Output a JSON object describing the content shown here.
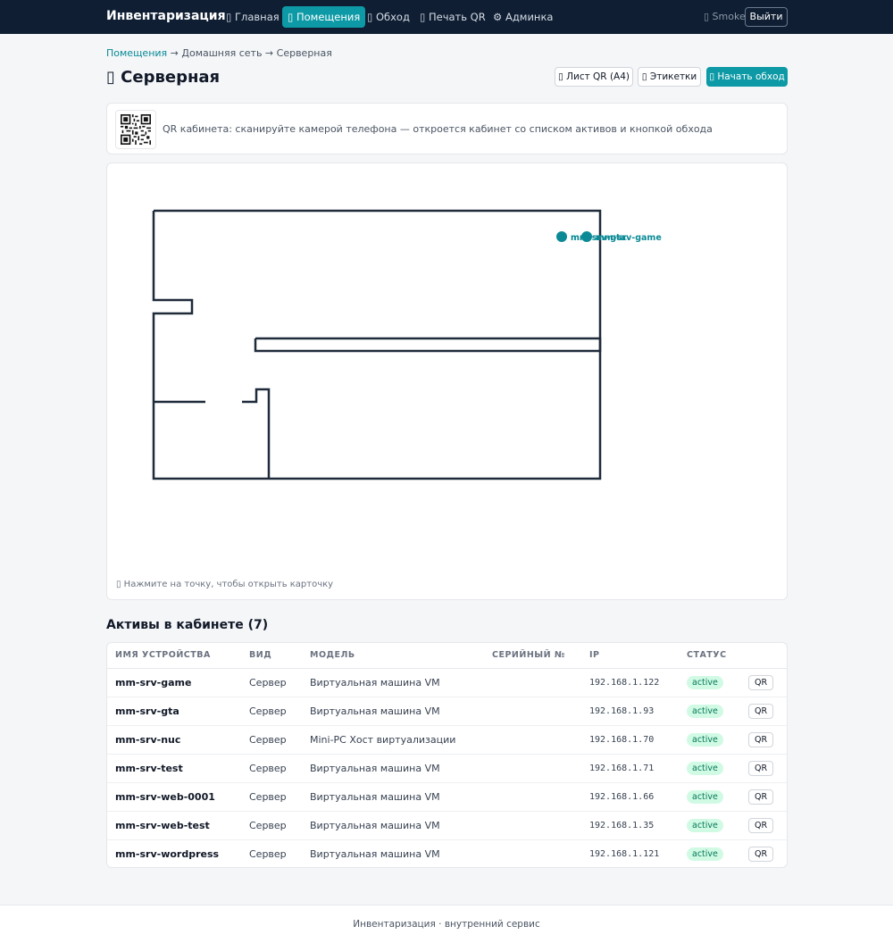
{
  "nav": {
    "brand": "Инвентаризация",
    "items": [
      {
        "label": "▯ Главная"
      },
      {
        "label": "▯ Помещения"
      },
      {
        "label": "▯ Обход"
      },
      {
        "label": "▯ Печать QR"
      },
      {
        "label": "⚙ Админка"
      }
    ],
    "user": "▯ Smoke",
    "logout": "Выйти"
  },
  "breadcrumb": {
    "link": "Помещения",
    "rest": " → Домашняя сеть → Серверная"
  },
  "page": {
    "title": "▯ Серверная",
    "buttons": {
      "qr_sheet": "▯ Лист QR (A4)",
      "labels": "▯ Этикетки",
      "start_round": "▯ Начать обход"
    }
  },
  "qr_card": {
    "text": "QR кабинета: сканируйте камерой телефона — откроется кабинет со списком активов и кнопкой обхода"
  },
  "map": {
    "markers": [
      {
        "label": "mm-srv-gta"
      },
      {
        "label": "mm-srv-game"
      }
    ],
    "overlap_text": "mm-srv-nuc",
    "hint": "▯ Нажмите на точку, чтобы открыть карточку",
    "accent": "#0b8a96"
  },
  "assets": {
    "title": "Активы в кабинете (7)",
    "columns": [
      "ИМЯ УСТРОЙСТВА",
      "ВИД",
      "МОДЕЛЬ",
      "СЕРИЙНЫЙ №",
      "IP",
      "СТАТУС",
      ""
    ],
    "rows": [
      {
        "name": "mm-srv-game",
        "type": "Сервер",
        "model": "Виртуальная машина VM",
        "serial": "",
        "ip": "192.168.1.122",
        "status": "active",
        "action": "QR"
      },
      {
        "name": "mm-srv-gta",
        "type": "Сервер",
        "model": "Виртуальная машина VM",
        "serial": "",
        "ip": "192.168.1.93",
        "status": "active",
        "action": "QR"
      },
      {
        "name": "mm-srv-nuc",
        "type": "Сервер",
        "model": "Mini-PC Хост виртуализации",
        "serial": "",
        "ip": "192.168.1.70",
        "status": "active",
        "action": "QR"
      },
      {
        "name": "mm-srv-test",
        "type": "Сервер",
        "model": "Виртуальная машина VM",
        "serial": "",
        "ip": "192.168.1.71",
        "status": "active",
        "action": "QR"
      },
      {
        "name": "mm-srv-web-0001",
        "type": "Сервер",
        "model": "Виртуальная машина VM",
        "serial": "",
        "ip": "192.168.1.66",
        "status": "active",
        "action": "QR"
      },
      {
        "name": "mm-srv-web-test",
        "type": "Сервер",
        "model": "Виртуальная машина VM",
        "serial": "",
        "ip": "192.168.1.35",
        "status": "active",
        "action": "QR"
      },
      {
        "name": "mm-srv-wordpress",
        "type": "Сервер",
        "model": "Виртуальная машина VM",
        "serial": "",
        "ip": "192.168.1.121",
        "status": "active",
        "action": "QR"
      }
    ]
  },
  "footer": "Инвентаризация · внутренний сервис"
}
